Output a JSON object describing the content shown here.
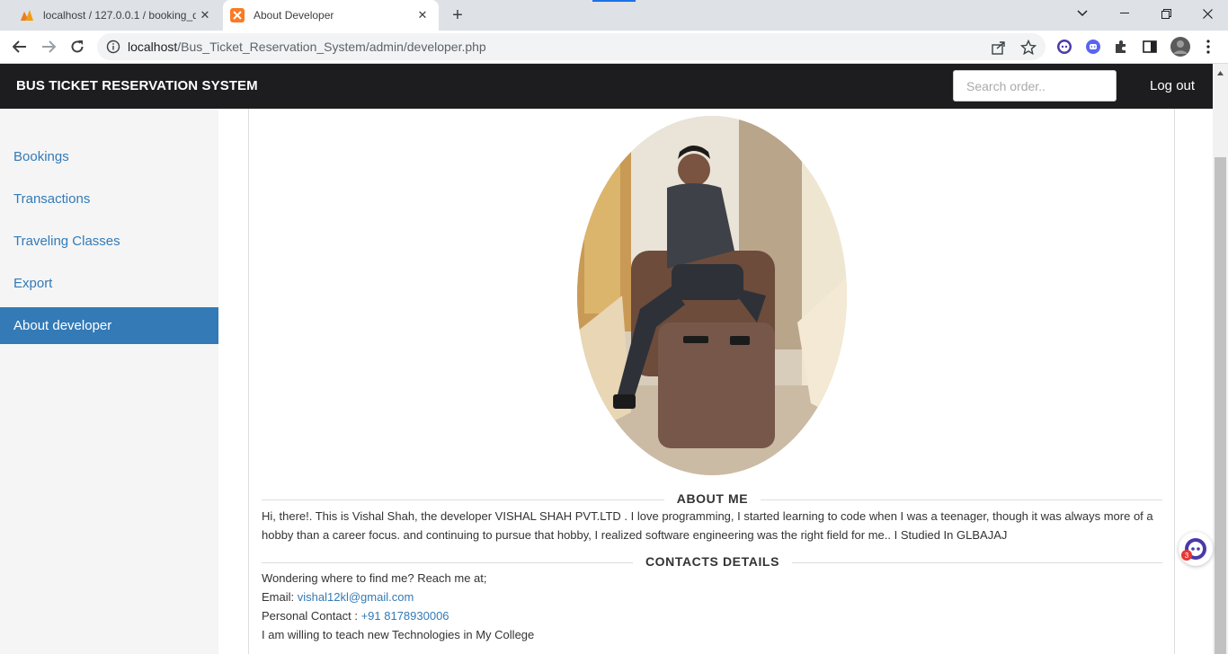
{
  "browser": {
    "tabs": [
      {
        "title": "localhost / 127.0.0.1 / booking_d",
        "active": false
      },
      {
        "title": "About Developer",
        "active": true
      }
    ],
    "new_tab_label": "+",
    "url_host": "localhost",
    "url_path": "/Bus_Ticket_Reservation_System/admin/developer.php"
  },
  "header": {
    "brand": "BUS TICKET RESERVATION SYSTEM",
    "search_placeholder": "Search order..",
    "logout_label": "Log out"
  },
  "sidebar": {
    "items": [
      {
        "label": "Bookings",
        "active": false
      },
      {
        "label": "Transactions",
        "active": false
      },
      {
        "label": "Traveling Classes",
        "active": false
      },
      {
        "label": "Export",
        "active": false
      },
      {
        "label": "About developer",
        "active": true
      }
    ]
  },
  "about": {
    "heading": "ABOUT ME",
    "text": "Hi, there!. This is Vishal Shah, the developer VISHAL SHAH PVT.LTD . I love programming, I started learning to code when I was a teenager, though it was always more of a hobby than a career focus. and continuing to pursue that hobby, I realized software engineering was the right field for me.. I Studied In GLBAJAJ"
  },
  "contacts": {
    "heading": "CONTACTS DETAILS",
    "intro": "Wondering where to find me? Reach me at;",
    "email_label": "Email:",
    "email": "vishal12kl@gmail.com",
    "phone_label": "Personal Contact :",
    "phone": "+91 8178930006",
    "note": "I am willing to teach new Technologies in My College"
  },
  "widget": {
    "badge_count": "3"
  },
  "colors": {
    "brand_bar": "#1d1d1f",
    "link": "#337ab7",
    "sidebar_bg": "#f5f5f5"
  }
}
